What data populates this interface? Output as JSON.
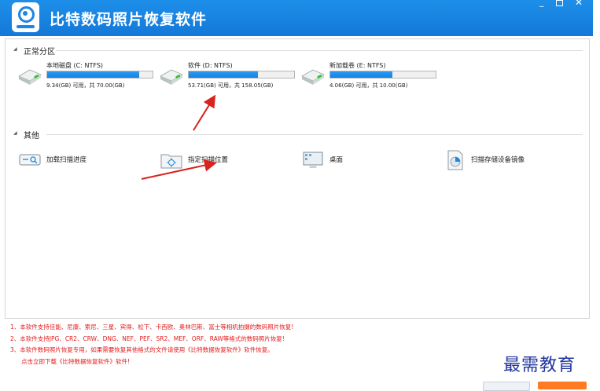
{
  "window": {
    "title": "比特数码照片恢复软件"
  },
  "sections": {
    "normal_partitions": "正常分区",
    "others": "其他"
  },
  "drives": [
    {
      "name": "本地磁盘 (C: NTFS)",
      "info": "9.34(GB) 可用，共 70.00(GB)",
      "used_fraction": 0.87
    },
    {
      "name": "软件 (D: NTFS)",
      "info": "53.71(GB) 可用，共 158.05(GB)",
      "used_fraction": 0.66
    },
    {
      "name": "新加载卷 (E: NTFS)",
      "info": "4.06(GB) 可用，共 10.00(GB)",
      "used_fraction": 0.59
    }
  ],
  "others": [
    {
      "label": "加载扫描进度",
      "icon": "load-scan-progress-icon"
    },
    {
      "label": "指定扫描位置",
      "icon": "specify-scan-location-icon"
    },
    {
      "label": "桌面",
      "icon": "desktop-icon"
    },
    {
      "label": "扫描存储设备镜像",
      "icon": "scan-storage-image-icon"
    }
  ],
  "notes": [
    "1、本软件支持佳能、尼康、索尼、三星、宾得、松下、卡西欧、奥林巴斯、富士等相机拍摄的数码照片恢复!",
    "2、本软件支持JPG、CR2、CRW、DNG、NEF、PEF、SR2、MEF、ORF、RAW等格式的数码照片恢复!",
    "3、本软件数码照片恢复专用，如果需要恢复其他格式的文件请使用《比特数据恢复软件》软件恢复。",
    "点击立即下载《比特数据恢复软件》软件!"
  ],
  "watermark": "最需教育",
  "colors": {
    "titlebar": "#1478d8",
    "progress": "#1a88e8",
    "note_text": "#e21a1a",
    "annotation_arrow": "#d9231f",
    "next_button": "#ff7a22"
  }
}
